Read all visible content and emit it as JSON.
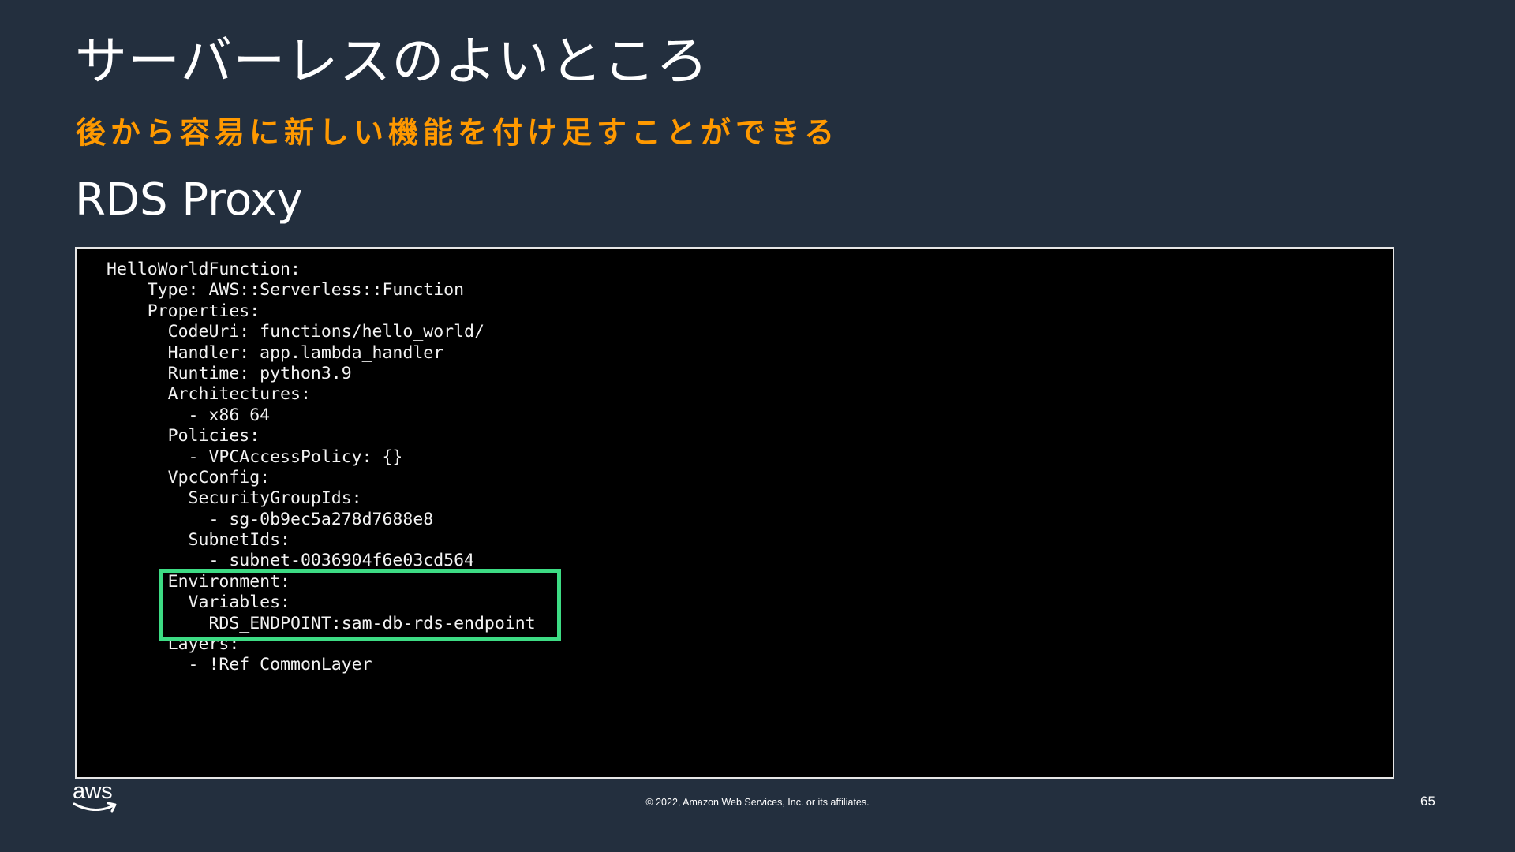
{
  "slide": {
    "title": "サーバーレスのよいところ",
    "subtitle": "後から容易に新しい機能を付け足すことができる",
    "section_heading": "RDS Proxy",
    "code_lines": [
      "HelloWorldFunction:",
      "    Type: AWS::Serverless::Function",
      "    Properties:",
      "      CodeUri: functions/hello_world/",
      "      Handler: app.lambda_handler",
      "      Runtime: python3.9",
      "      Architectures:",
      "        - x86_64",
      "      Policies:",
      "        - VPCAccessPolicy: {}",
      "      VpcConfig:",
      "        SecurityGroupIds:",
      "          - sg-0b9ec5a278d7688e8",
      "        SubnetIds:",
      "          - subnet-0036904f6e03cd564",
      "      Environment:",
      "        Variables:",
      "          RDS_ENDPOINT:sam-db-rds-endpoint",
      "      Layers:",
      "        - !Ref CommonLayer"
    ],
    "highlight_color": "#3ddc84",
    "accent_color": "#ff9900",
    "background_color": "#232f3e"
  },
  "footer": {
    "logo_text": "aws",
    "copyright": "© 2022, Amazon Web Services, Inc. or its affiliates.",
    "page_number": "65"
  }
}
